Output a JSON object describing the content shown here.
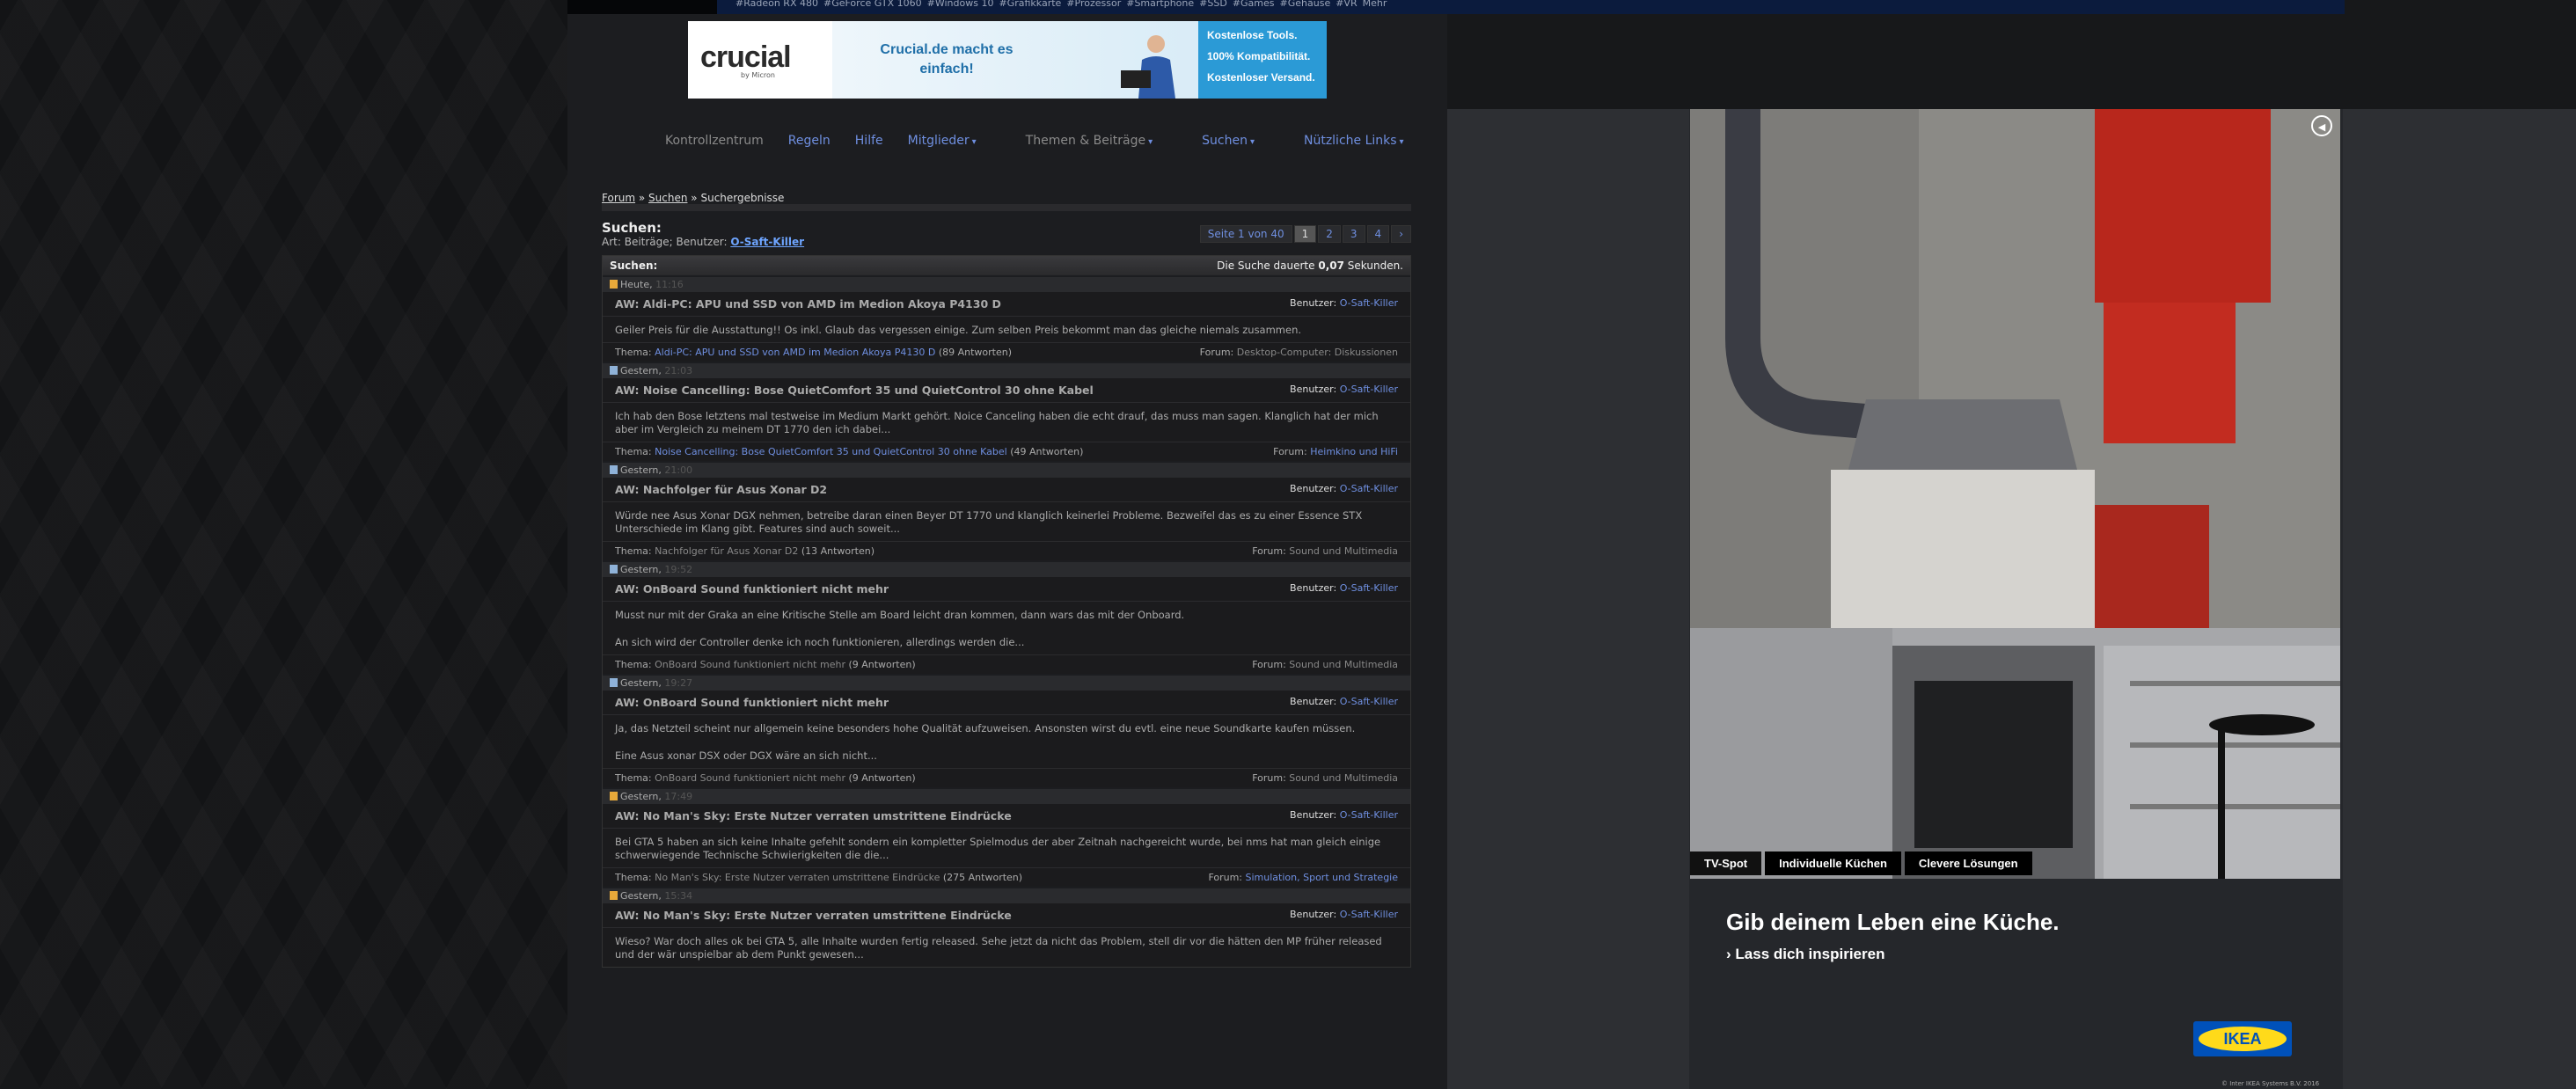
{
  "topnav": {
    "items": [
      "#Radeon RX 480",
      "#GeForce GTX 1060",
      "#Windows 10",
      "#Grafikkarte",
      "#Prozessor",
      "#Smartphone",
      "#SSD",
      "#Games",
      "#Gehäuse",
      "#VR",
      "Mehr"
    ]
  },
  "banner": {
    "brand": "crucial",
    "brand_sub": "by Micron",
    "tagline": "Crucial.de macht es einfach!",
    "features": [
      "Kostenlose Tools.",
      "100% Kompatibilität.",
      "Kostenloser Versand."
    ]
  },
  "mainnav": [
    {
      "label": "Kontrollzentrum",
      "dropdown": false,
      "dim": true
    },
    {
      "label": "Regeln",
      "dropdown": false,
      "dim": false
    },
    {
      "label": "Hilfe",
      "dropdown": false,
      "dim": false
    },
    {
      "label": "Mitglieder",
      "dropdown": true,
      "dim": false
    },
    {
      "label": "Themen & Beiträge",
      "dropdown": true,
      "dim": true
    },
    {
      "label": "Suchen",
      "dropdown": true,
      "dim": false
    },
    {
      "label": "Nützliche Links",
      "dropdown": true,
      "dim": false
    }
  ],
  "breadcrumb": {
    "forum": "Forum",
    "sep": "»",
    "search": "Suchen",
    "current": "Suchergebnisse"
  },
  "search": {
    "title": "Suchen:",
    "info_prefix": "Art: Beiträge; Benutzer:",
    "user": "O-Saft-Killer"
  },
  "pager": {
    "label": "Seite 1 von 40",
    "pages": [
      "1",
      "2",
      "3",
      "4"
    ],
    "next": "›"
  },
  "results_header": {
    "title": "Suchen:",
    "time_prefix": "Die Suche dauerte",
    "time_value": "0,07",
    "time_suffix": "Sekunden."
  },
  "posts": [
    {
      "day": "Heute,",
      "time": "11:16",
      "unread": true,
      "title": "AW: Aldi-PC: APU und SSD von AMD im Medion Akoya P4130 D",
      "user_label": "Benutzer:",
      "user": "O-Saft-Killer",
      "body": [
        "Geiler Preis für die Ausstattung!! Os inkl. Glaub das vergessen einige. Zum selben Preis bekommt man das gleiche niemals zusammen."
      ],
      "thema_label": "Thema:",
      "thema": "Aldi-PC: APU und SSD von AMD im Medion Akoya P4130 D",
      "replies": "(89 Antworten)",
      "forum_label": "Forum:",
      "forum": "Desktop-Computer: Diskussionen",
      "forum_link": false
    },
    {
      "day": "Gestern,",
      "time": "21:03",
      "unread": false,
      "title": "AW: Noise Cancelling: Bose QuietComfort 35 und QuietControl 30 ohne Kabel",
      "user_label": "Benutzer:",
      "user": "O-Saft-Killer",
      "body": [
        "Ich hab den Bose letztens mal testweise im Medium Markt gehört. Noice Canceling haben die echt drauf, das muss man sagen. Klanglich hat der mich aber im Vergleich zu meinem DT 1770 den ich dabei..."
      ],
      "thema_label": "Thema:",
      "thema": "Noise Cancelling: Bose QuietComfort 35 und QuietControl 30 ohne Kabel",
      "replies": "(49 Antworten)",
      "forum_label": "Forum:",
      "forum": "Heimkino und HiFi",
      "forum_link": true
    },
    {
      "day": "Gestern,",
      "time": "21:00",
      "unread": false,
      "title": "AW: Nachfolger für Asus Xonar D2",
      "user_label": "Benutzer:",
      "user": "O-Saft-Killer",
      "body": [
        "Würde nee Asus Xonar DGX nehmen, betreibe daran einen Beyer DT 1770 und klanglich keinerlei Probleme. Bezweifel das es zu einer Essence STX Unterschiede im Klang gibt. Features sind auch soweit..."
      ],
      "thema_label": "Thema:",
      "thema": "Nachfolger für Asus Xonar D2",
      "replies": "(13 Antworten)",
      "forum_label": "Forum:",
      "forum": "Sound und Multimedia",
      "forum_link": false
    },
    {
      "day": "Gestern,",
      "time": "19:52",
      "unread": false,
      "title": "AW: OnBoard Sound funktioniert nicht mehr",
      "user_label": "Benutzer:",
      "user": "O-Saft-Killer",
      "body": [
        "Musst nur mit der Graka an eine Kritische Stelle am Board leicht dran kommen, dann wars das mit der Onboard.",
        "An sich wird der Controller denke ich noch funktionieren, allerdings werden die..."
      ],
      "thema_label": "Thema:",
      "thema": "OnBoard Sound funktioniert nicht mehr",
      "replies": "(9 Antworten)",
      "forum_label": "Forum:",
      "forum": "Sound und Multimedia",
      "forum_link": false
    },
    {
      "day": "Gestern,",
      "time": "19:27",
      "unread": false,
      "title": "AW: OnBoard Sound funktioniert nicht mehr",
      "user_label": "Benutzer:",
      "user": "O-Saft-Killer",
      "body": [
        "Ja, das Netzteil scheint nur allgemein keine besonders hohe Qualität aufzuweisen. Ansonsten wirst du evtl. eine neue Soundkarte kaufen müssen.",
        "Eine Asus xonar DSX oder DGX wäre an sich nicht..."
      ],
      "thema_label": "Thema:",
      "thema": "OnBoard Sound funktioniert nicht mehr",
      "replies": "(9 Antworten)",
      "forum_label": "Forum:",
      "forum": "Sound und Multimedia",
      "forum_link": false
    },
    {
      "day": "Gestern,",
      "time": "17:49",
      "unread": true,
      "title": "AW: No Man's Sky: Erste Nutzer verraten umstrittene Eindrücke",
      "user_label": "Benutzer:",
      "user": "O-Saft-Killer",
      "body": [
        "Bei GTA 5 haben an sich keine Inhalte gefehlt sondern ein kompletter Spielmodus der aber Zeitnah nachgereicht wurde, bei nms hat man gleich einige schwerwiegende Technische Schwierigkeiten die die..."
      ],
      "thema_label": "Thema:",
      "thema": "No Man's Sky: Erste Nutzer verraten umstrittene Eindrücke",
      "replies": "(275 Antworten)",
      "forum_label": "Forum:",
      "forum": "Simulation, Sport und Strategie",
      "forum_link": true
    },
    {
      "day": "Gestern,",
      "time": "15:34",
      "unread": true,
      "title": "AW: No Man's Sky: Erste Nutzer verraten umstrittene Eindrücke",
      "user_label": "Benutzer:",
      "user": "O-Saft-Killer",
      "body": [
        "Wieso? War doch alles ok bei GTA 5, alle Inhalte wurden fertig released. Sehe jetzt da nicht das Problem, stell dir vor die hätten den MP früher released und der wär unspielbar ab dem Punkt gewesen..."
      ],
      "thema_label": "Thema:",
      "thema": "",
      "replies": "",
      "forum_label": "",
      "forum": "",
      "forum_link": false
    }
  ],
  "ad": {
    "tabs": [
      "TV-Spot",
      "Individuelle Küchen",
      "Clevere Lösungen"
    ],
    "headline": "Gib deinem Leben eine Küche.",
    "cta": "Lass dich inspirieren",
    "logo": "IKEA",
    "copyright": "© Inter IKEA Systems B.V. 2016"
  }
}
